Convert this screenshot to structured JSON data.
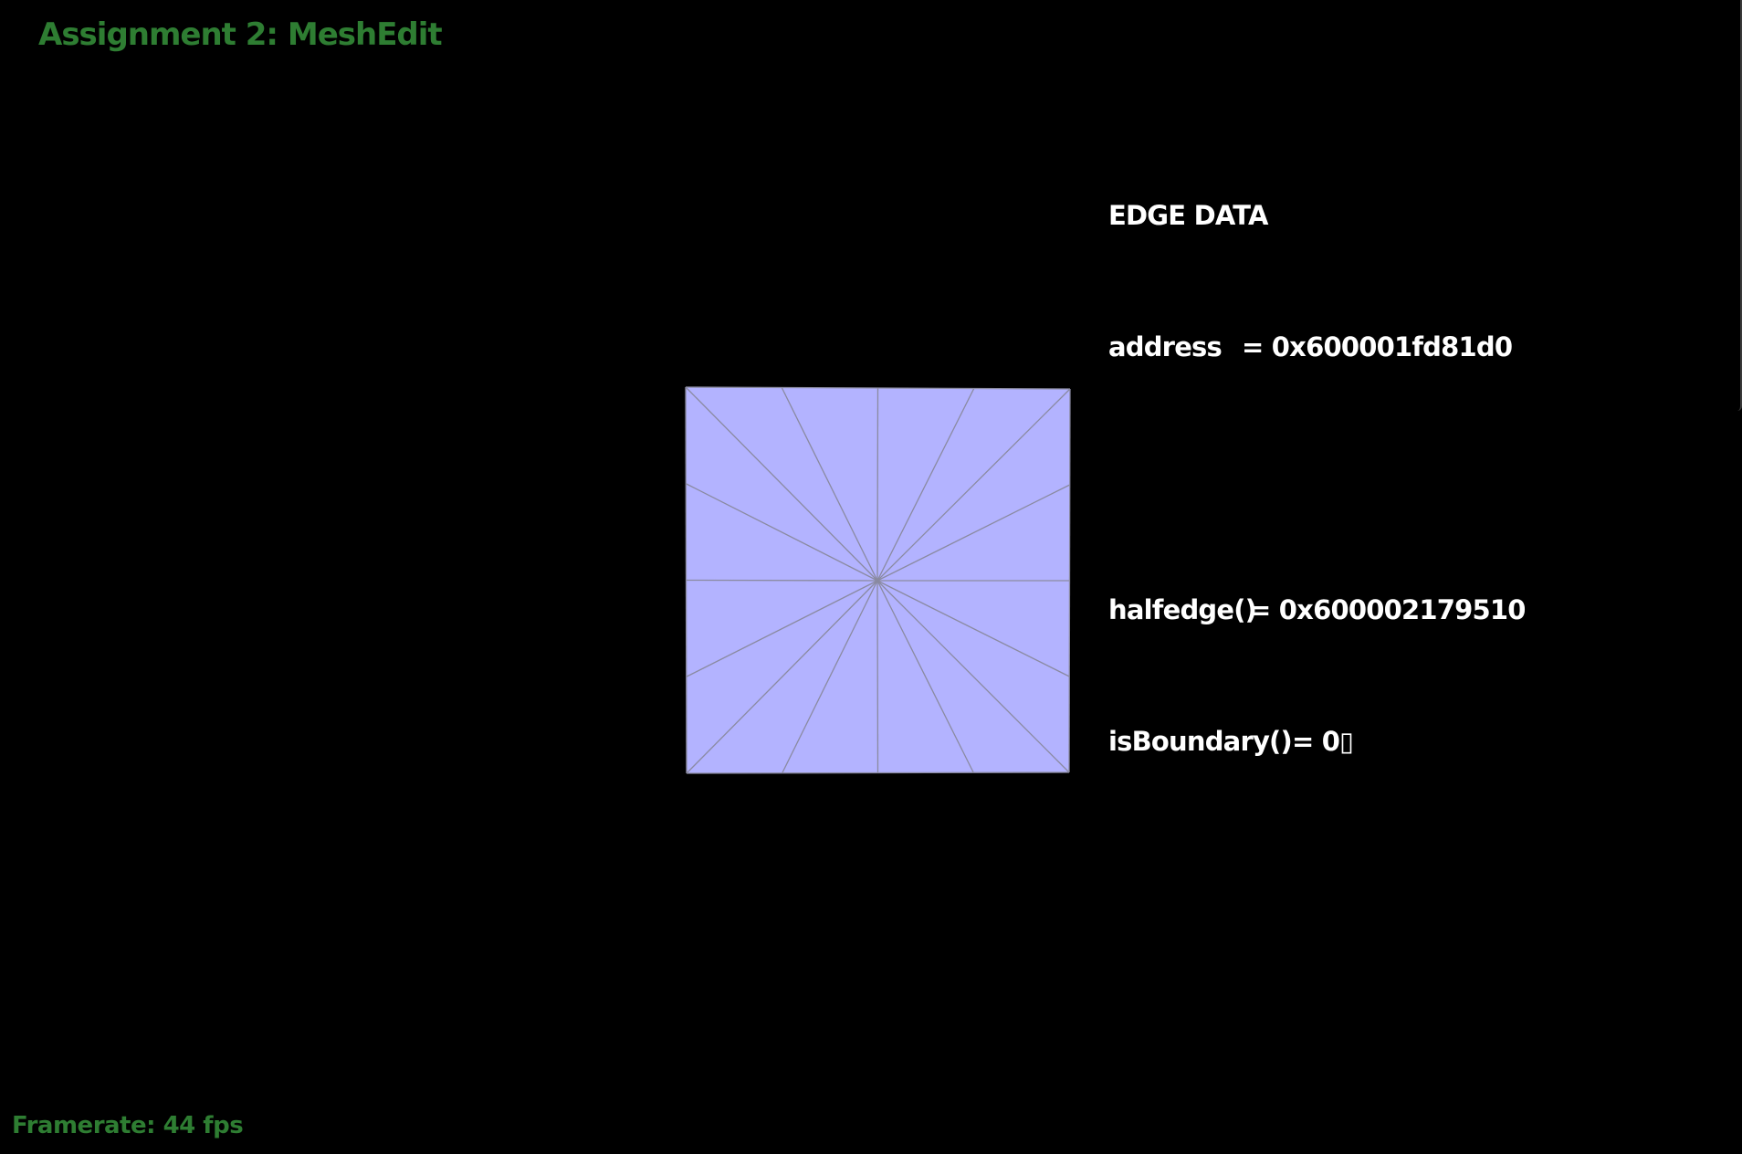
{
  "app": {
    "title": "Assignment 2: MeshEdit",
    "title_color": "#2e7d32"
  },
  "status": {
    "framerate_text": "Framerate: 44 fps",
    "color": "#2e7d32"
  },
  "edge_data": {
    "heading": "EDGE DATA",
    "rows": [
      {
        "label": "address",
        "value": "= 0x600001fd81d0"
      },
      {
        "label": "halfedge()",
        "value": "= 0x600002179510"
      },
      {
        "label": "isBoundary()",
        "value": "= 0▯"
      }
    ]
  },
  "mesh": {
    "face_color": "#b3b3ff",
    "edge_color": "#8a8aa0",
    "spoke_divisions_per_side": 4
  }
}
